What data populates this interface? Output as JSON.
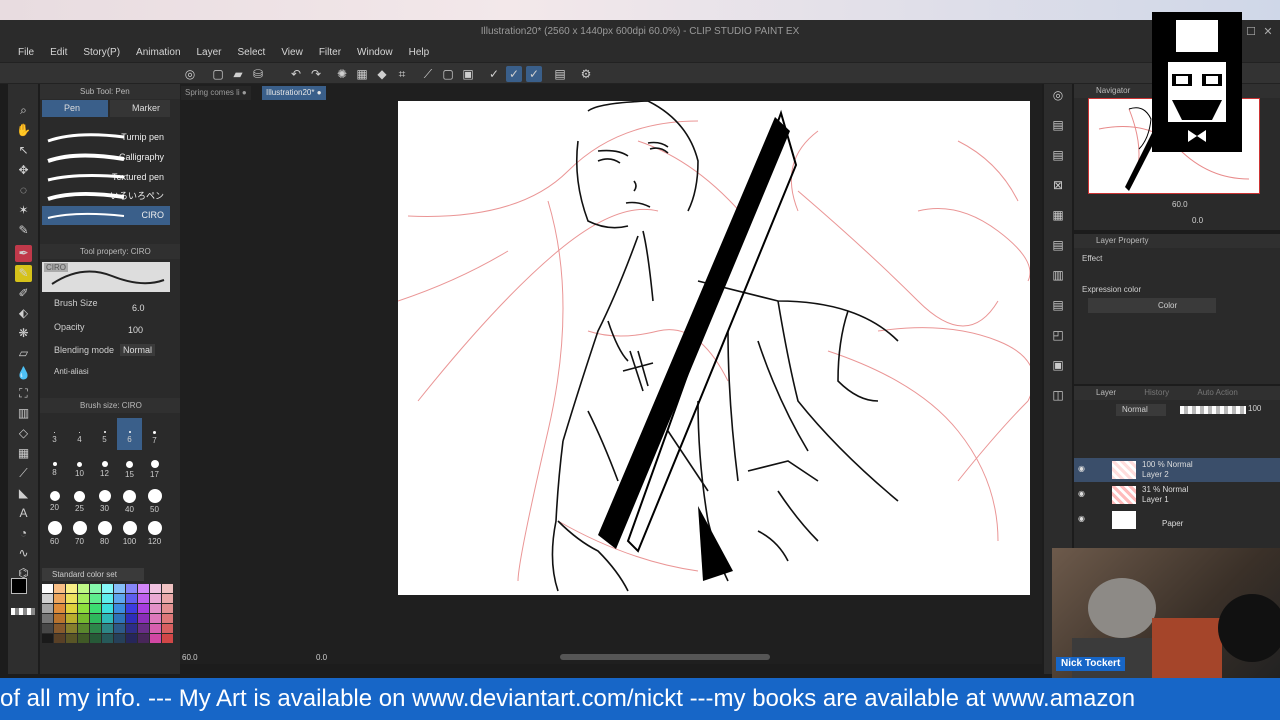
{
  "titlebar": {
    "title": "Illustration20* (2560 x 1440px 600dpi 60.0%)  - CLIP STUDIO PAINT EX"
  },
  "menu": [
    "File",
    "Edit",
    "Story(P)",
    "Animation",
    "Layer",
    "Select",
    "View",
    "Filter",
    "Window",
    "Help"
  ],
  "doc_tabs": [
    {
      "label": "Spring comes li"
    },
    {
      "label": "Illustration20*"
    }
  ],
  "sub_tool": {
    "header": "Sub Tool: Pen",
    "tabs": [
      "Pen",
      "Marker"
    ],
    "brushes": [
      "Turnip pen",
      "Calligraphy",
      "Textured pen",
      "いろいろペン",
      "CIRO"
    ]
  },
  "tool_property": {
    "header": "Tool property: CIRO",
    "preview_label": "CIRO",
    "brush_size_label": "Brush Size",
    "brush_size_value": "6.0",
    "opacity_label": "Opacity",
    "opacity_value": "100",
    "blending_label": "Blending mode",
    "blending_value": "Normal",
    "antialias_label": "Anti-aliasi"
  },
  "brush_size_panel": {
    "header": "Brush size: CIRO",
    "sizes": [
      "3",
      "4",
      "5",
      "6",
      "7",
      "8",
      "10",
      "12",
      "15",
      "17",
      "20",
      "25",
      "30",
      "40",
      "50",
      "60",
      "70",
      "80",
      "100",
      "120"
    ]
  },
  "color_set": {
    "label": "Standard color set"
  },
  "status": {
    "zoom": "60.0",
    "angle": "0.0"
  },
  "navigator": {
    "header": "Navigator",
    "zoom": "60.0",
    "angle": "0.0"
  },
  "layer_property": {
    "header": "Layer Property",
    "effect_label": "Effect",
    "expression_label": "Expression color",
    "expression_value": "Color"
  },
  "layer_panel": {
    "tabs": [
      "Layer",
      "History",
      "Auto Action"
    ],
    "blend": "Normal",
    "opacity": "100",
    "layers": [
      {
        "mode": "100 % Normal",
        "name": "Layer 2"
      },
      {
        "mode": "31 % Normal",
        "name": "Layer 1"
      },
      {
        "mode": "",
        "name": "Paper"
      }
    ]
  },
  "webcam": {
    "name": "Nick Tockert"
  },
  "ticker": {
    "text": "of all my info. --- My Art is available on www.deviantart.com/nickt ---my books are available at www.amazon"
  },
  "colors": {
    "accent": "#3a5f8a",
    "ticker_bg": "#1766c7",
    "sketch_red": "#e88a8a"
  }
}
